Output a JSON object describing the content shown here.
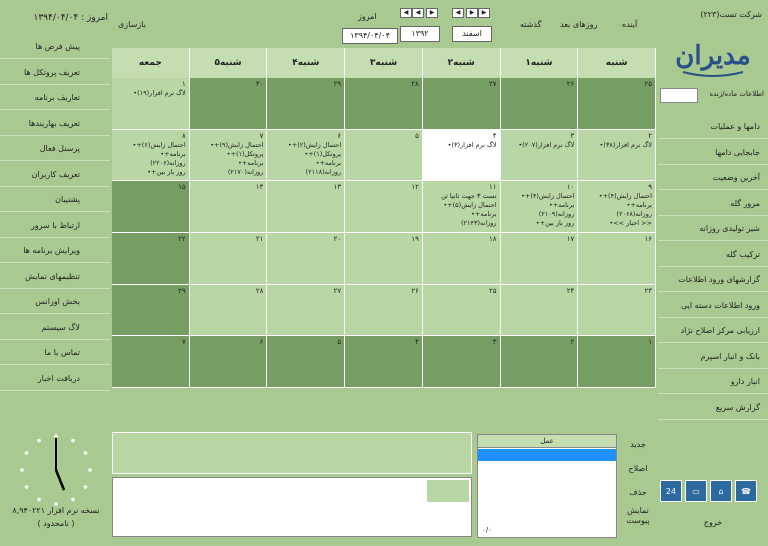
{
  "left": {
    "today_label": "امروز : ۱۳۹۴/۰۴/۰۴",
    "menu": [
      "پیش فرض ها",
      "تعریف پروتکل ها",
      "تعاریف برنامه",
      "تعریف بهاربندها",
      "پرسنل فعال",
      "تعریف کاربران",
      "پشتیبان",
      "ارتباط با سرور",
      "ویرایش برنامه ها",
      "تنظیمهای نمایش",
      "بخش اوزانس",
      "لاگ سیستم",
      "تماس با ما",
      "دریافت اخبار"
    ],
    "version": "نسخه نرم افزار ۸,۹۴۰۲۲۱",
    "license": "( نامحدود )"
  },
  "right": {
    "company": "شرکت تست(۲۲۳)",
    "logo_text": "مدیران",
    "lookup_label": "اطلاعات ماده/زنده",
    "menu": [
      "دامها و عملیات",
      "جابجایی دامها",
      "آخرین وضعیت",
      "مرور گله",
      "شیر تولیدی روزانه",
      "ترکیب گله",
      "گزارشهای ورود اطلاعات",
      "ورود اطلاعات دسته ایی",
      "ارزیابی مرکز اصلاح نژاد",
      "بانک و انبار اسپرم",
      "انبار دارو",
      "گزارش سریع"
    ],
    "exit": "خروج",
    "icons": [
      "calendar-24-icon",
      "monitor-icon",
      "home-icon",
      "phone-icon"
    ]
  },
  "top": {
    "resync": "بازسازی",
    "today_title": "امروز",
    "today_date": "۱۳۹۴/۰۴/۰۴",
    "year": "۱۳۹۲",
    "month": "اسفند",
    "past": "گذشته",
    "next_days": "روزهای بعد",
    "future": "آینده"
  },
  "calendar": {
    "days": [
      "شنبه",
      "۱شنبه",
      "۲شنبه",
      "۳شنبه",
      "۴شنبه",
      "۵شنبه",
      "جمعه"
    ],
    "rows": [
      [
        {
          "n": "۲۵",
          "d": 1,
          "e": []
        },
        {
          "n": "۲۶",
          "d": 1,
          "e": []
        },
        {
          "n": "۲۷",
          "d": 1,
          "e": []
        },
        {
          "n": "۲۸",
          "d": 1,
          "e": []
        },
        {
          "n": "۲۹",
          "d": 1,
          "e": []
        },
        {
          "n": "۳۰",
          "d": 1,
          "e": []
        },
        {
          "n": "۱",
          "d": 0,
          "e": [
            "•لاگ نرم افزار(۱۹)"
          ]
        }
      ],
      [
        {
          "n": "۲",
          "d": 0,
          "e": [
            "•لاگ نرم افزار(۳۸)"
          ]
        },
        {
          "n": "۳",
          "d": 0,
          "e": [
            "•لاگ نرم افزار(۲۰۷)"
          ]
        },
        {
          "n": "۴",
          "d": 0,
          "t": 1,
          "e": [
            "•لاگ نرم افزار(۳)"
          ]
        },
        {
          "n": "۵",
          "d": 0,
          "e": []
        },
        {
          "n": "۶",
          "d": 0,
          "e": [
            "•+احتمال زایش(۲)",
            "•+پروتکل(۱)",
            "•+برنامه",
            "روزانه(۲۱۱۸)"
          ]
        },
        {
          "n": "۷",
          "d": 0,
          "e": [
            "•+احتمال زایش(۹)",
            "•+پروتکل(۱)",
            "•+برنامه",
            "روزانه(۲۱۷۰)"
          ]
        },
        {
          "n": "۸",
          "d": 0,
          "e": [
            "•+احتمال زایش(۶)",
            "•+برنامه",
            "روزانه(۲۲۰۶)",
            "•+روز باز بین"
          ]
        }
      ],
      [
        {
          "n": "۹",
          "d": 0,
          "e": [
            "•+احتمال زایش(۴)",
            "•+برنامه",
            "روزانه(۲۰۶۸)",
            "•<< اخبار >>"
          ]
        },
        {
          "n": "۱۰",
          "d": 0,
          "e": [
            "•+احتمال زایش(۴)",
            "•+برنامه",
            "روزانه(۲۱۰۹)",
            "•+روز باز بین"
          ]
        },
        {
          "n": "۱۱",
          "d": 0,
          "e": [
            "تست ۳ جهت ثانیا ثن",
            "•+احتمال زایش(۵)",
            "•+برنامه",
            "روزانه(۲۱۴۳)"
          ]
        },
        {
          "n": "۱۲",
          "d": 0,
          "e": []
        },
        {
          "n": "۱۳",
          "d": 0,
          "e": []
        },
        {
          "n": "۱۴",
          "d": 0,
          "e": []
        },
        {
          "n": "۱۵",
          "d": 1,
          "e": []
        }
      ],
      [
        {
          "n": "۱۶",
          "d": 0,
          "e": []
        },
        {
          "n": "۱۷",
          "d": 0,
          "e": []
        },
        {
          "n": "۱۸",
          "d": 0,
          "e": []
        },
        {
          "n": "۱۹",
          "d": 0,
          "e": []
        },
        {
          "n": "۲۰",
          "d": 0,
          "e": []
        },
        {
          "n": "۲۱",
          "d": 0,
          "e": []
        },
        {
          "n": "۲۲",
          "d": 1,
          "e": []
        }
      ],
      [
        {
          "n": "۲۳",
          "d": 0,
          "e": []
        },
        {
          "n": "۲۴",
          "d": 0,
          "e": []
        },
        {
          "n": "۲۵",
          "d": 0,
          "e": []
        },
        {
          "n": "۲۶",
          "d": 0,
          "e": []
        },
        {
          "n": "۲۷",
          "d": 0,
          "e": []
        },
        {
          "n": "۲۸",
          "d": 0,
          "e": []
        },
        {
          "n": "۲۹",
          "d": 1,
          "e": []
        }
      ],
      [
        {
          "n": "۱",
          "d": 1,
          "e": []
        },
        {
          "n": "۲",
          "d": 1,
          "e": []
        },
        {
          "n": "۳",
          "d": 1,
          "e": []
        },
        {
          "n": "۴",
          "d": 1,
          "e": []
        },
        {
          "n": "۵",
          "d": 1,
          "e": []
        },
        {
          "n": "۶",
          "d": 1,
          "e": []
        },
        {
          "n": "۷",
          "d": 1,
          "e": []
        }
      ]
    ]
  },
  "bottom": {
    "work_header": "عمل",
    "count": "۰/۰",
    "new": "جدید",
    "edit": "اصلاح",
    "delete": "حذف",
    "show_attachment": "نمایش پیوست"
  }
}
